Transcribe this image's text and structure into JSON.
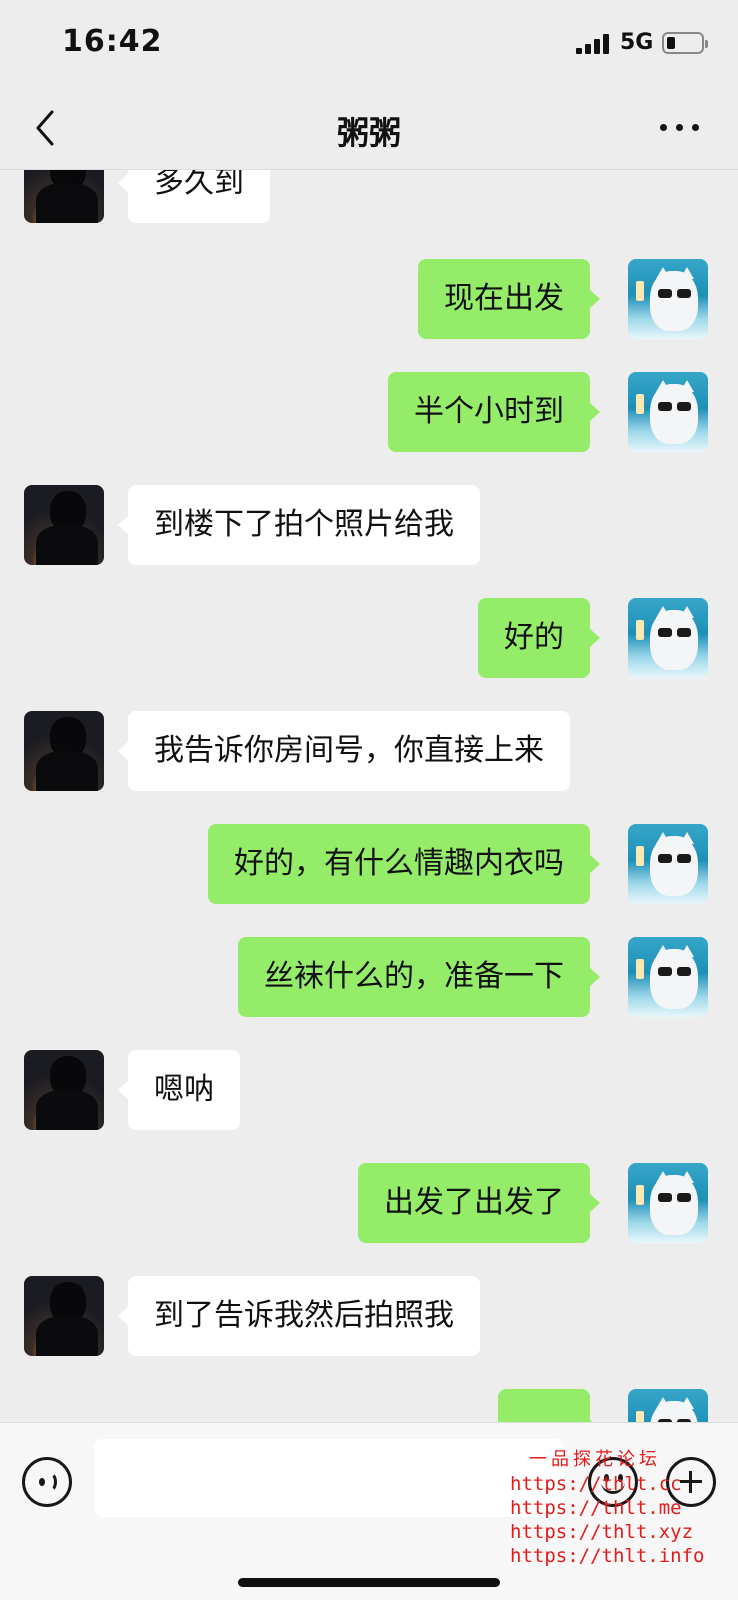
{
  "status_bar": {
    "time": "16:42",
    "network": "5G"
  },
  "nav": {
    "title": "粥粥"
  },
  "messages": [
    {
      "side": "left",
      "text": "多久到"
    },
    {
      "side": "right",
      "text": "现在出发"
    },
    {
      "side": "right",
      "text": "半个小时到"
    },
    {
      "side": "left",
      "text": "到楼下了拍个照片给我"
    },
    {
      "side": "right",
      "text": "好的"
    },
    {
      "side": "left",
      "text": "我告诉你房间号，你直接上来"
    },
    {
      "side": "right",
      "text": "好的，有什么情趣内衣吗"
    },
    {
      "side": "right",
      "text": "丝袜什么的，准备一下"
    },
    {
      "side": "left",
      "text": "嗯呐"
    },
    {
      "side": "right",
      "text": "出发了出发了"
    },
    {
      "side": "left",
      "text": "到了告诉我然后拍照我"
    },
    {
      "side": "right",
      "text": ""
    }
  ],
  "input": {
    "value": ""
  },
  "watermark": {
    "title": "一品探花论坛",
    "lines": [
      "https://thlt.cc",
      "https://thlt.me",
      "https://thlt.xyz",
      "https://thlt.info"
    ]
  },
  "colors": {
    "background": "#ededed",
    "outgoing_bubble": "#95ec69",
    "incoming_bubble": "#ffffff",
    "watermark": "#e51a1a"
  }
}
